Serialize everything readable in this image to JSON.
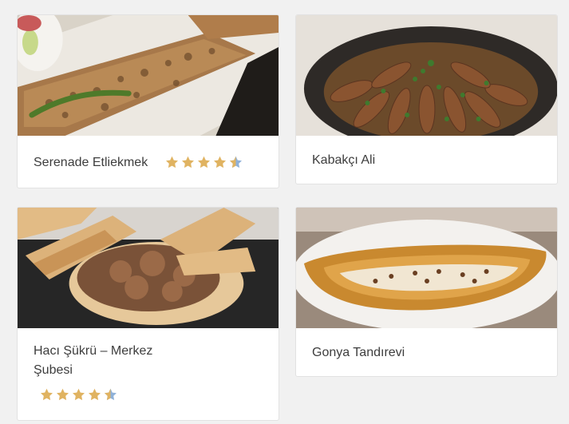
{
  "colors": {
    "star_filled": "#e0b361",
    "star_half": "#8fb1d9",
    "card_bg": "#ffffff",
    "page_bg": "#f1f1f1"
  },
  "restaurants": [
    {
      "name": "Serenade Etliekmek",
      "rating": 4.5,
      "image": "lahmacun-photo"
    },
    {
      "name": "Kabakçı Ali",
      "rating": null,
      "image": "kebab-pot-photo"
    },
    {
      "name": "Hacı Şükrü – Merkez Şubesi",
      "rating": 4.5,
      "image": "doner-bread-photo"
    },
    {
      "name": "Gonya Tandırevi",
      "rating": null,
      "image": "pide-photo"
    }
  ]
}
